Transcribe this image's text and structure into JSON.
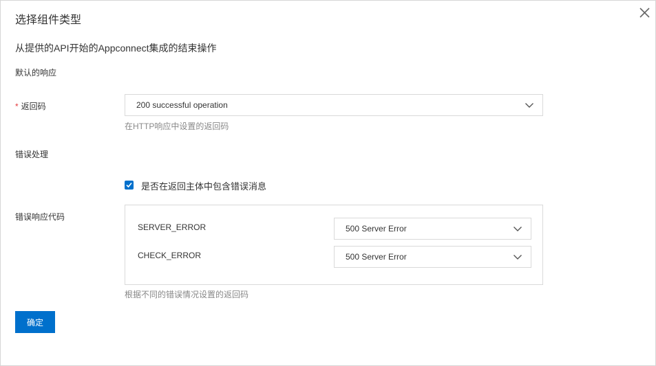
{
  "dialog": {
    "title": "选择组件类型",
    "close_icon": "close-icon",
    "description": "从提供的API开始的Appconnect集成的结束操作"
  },
  "default_response": {
    "section_title": "默认的响应",
    "return_code": {
      "required_mark": "*",
      "label": "返回码",
      "value": "200 successful operation",
      "hint": "在HTTP响应中设置的返回码"
    }
  },
  "error_handling": {
    "section_title": "错误处理",
    "include_error_checkbox": {
      "checked": true,
      "label": "是否在返回主体中包含错误消息"
    },
    "error_codes_label": "错误响应代码",
    "error_codes": [
      {
        "name": "SERVER_ERROR",
        "value": "500 Server Error"
      },
      {
        "name": "CHECK_ERROR",
        "value": "500 Server Error"
      }
    ],
    "hint": "根据不同的错误情况设置的返回码"
  },
  "actions": {
    "confirm_label": "确定"
  },
  "colors": {
    "primary": "#0070cc",
    "border": "#d9d9d9",
    "required": "#e4393c",
    "hint_text": "#888888"
  }
}
